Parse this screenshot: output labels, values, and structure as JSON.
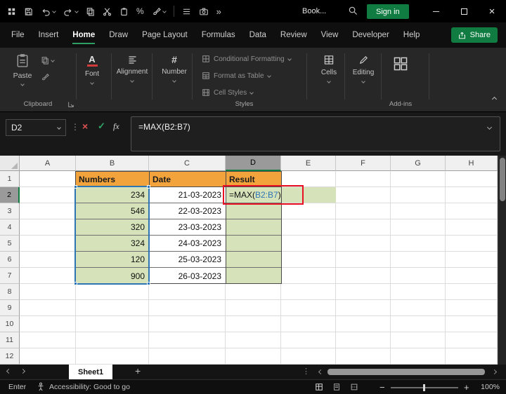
{
  "titlebar": {
    "document_name": "Book...",
    "sign_in_label": "Sign in"
  },
  "tabs": {
    "items": [
      "File",
      "Insert",
      "Home",
      "Draw",
      "Page Layout",
      "Formulas",
      "Data",
      "Review",
      "View",
      "Developer",
      "Help"
    ],
    "active": "Home",
    "share_label": "Share"
  },
  "ribbon": {
    "paste_label": "Paste",
    "clipboard_group_label": "Clipboard",
    "font_label": "Font",
    "alignment_label": "Alignment",
    "number_label": "Number",
    "conditional_formatting_label": "Conditional Formatting",
    "format_as_table_label": "Format as Table",
    "cell_styles_label": "Cell Styles",
    "styles_group_label": "Styles",
    "cells_label": "Cells",
    "editing_label": "Editing",
    "addins_group_label": "Add-ins"
  },
  "formula_bar": {
    "name_box_value": "D2",
    "fx_label": "fx",
    "formula": "=MAX(B2:B7)"
  },
  "sheet": {
    "column_headers": [
      "A",
      "B",
      "C",
      "D",
      "E",
      "F",
      "G",
      "H"
    ],
    "row_headers": [
      "1",
      "2",
      "3",
      "4",
      "5",
      "6",
      "7",
      "8",
      "9",
      "10",
      "11",
      "12"
    ],
    "table_headers": {
      "numbers": "Numbers",
      "date": "Date",
      "result": "Result"
    },
    "rows": [
      {
        "number": "234",
        "date": "21-03-2023"
      },
      {
        "number": "546",
        "date": "22-03-2023"
      },
      {
        "number": "320",
        "date": "23-03-2023"
      },
      {
        "number": "324",
        "date": "24-03-2023"
      },
      {
        "number": "120",
        "date": "25-03-2023"
      },
      {
        "number": "900",
        "date": "26-03-2023"
      }
    ],
    "active_cell": "D2",
    "formula_parts": {
      "prefix": "=MAX(",
      "range": "B2:B7",
      "suffix": ")"
    }
  },
  "sheet_tabs": {
    "sheet_name": "Sheet1"
  },
  "status_bar": {
    "mode": "Enter",
    "accessibility_label": "Accessibility: Good to go",
    "zoom_value": "100%"
  },
  "colors": {
    "excel_green": "#107C41",
    "table_header_orange": "#F3A33C",
    "cell_fill_green": "#D6E3BA",
    "range_reference_blue": "#2E75B6",
    "annotation_red": "#E81123"
  }
}
